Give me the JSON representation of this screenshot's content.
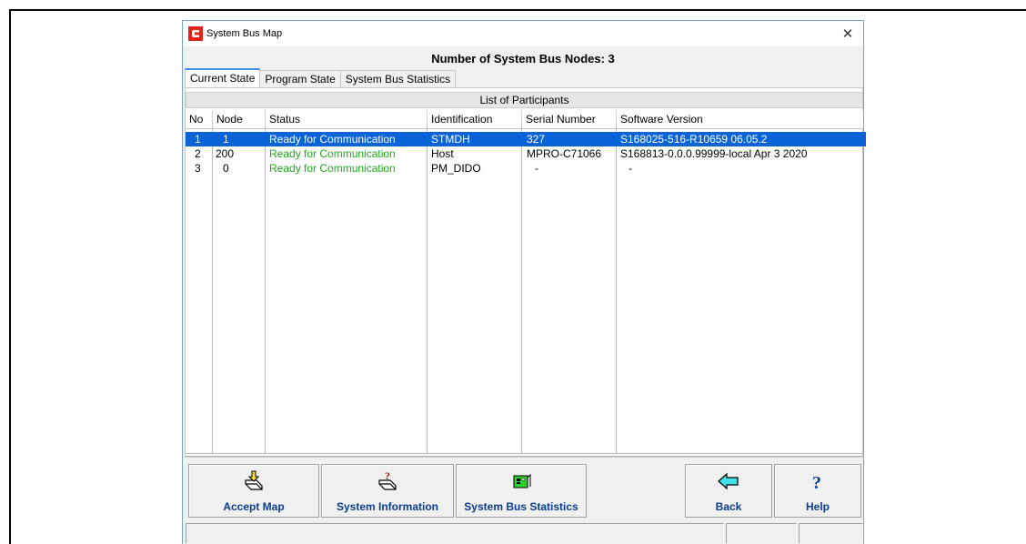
{
  "window": {
    "title": "System Bus Map",
    "close_glyph": "✕"
  },
  "header": {
    "title": "Number of System Bus Nodes: 3"
  },
  "tabs": [
    {
      "label": "Current State",
      "active": true
    },
    {
      "label": "Program State",
      "active": false
    },
    {
      "label": "System Bus Statistics",
      "active": false
    }
  ],
  "list": {
    "caption": "List of Participants",
    "columns": [
      "No",
      "Node",
      "Status",
      "Identification",
      "Serial Number",
      "Software Version"
    ],
    "rows": [
      {
        "no": "1",
        "node": "1",
        "status": "Ready for Communication",
        "identification": "STMDH",
        "serial": "327",
        "software": "S168025-516-R10659 06.05.2",
        "selected": true
      },
      {
        "no": "2",
        "node": "200",
        "status": "Ready for Communication",
        "identification": "Host",
        "serial": "MPRO-C71066",
        "software": "S168813-0.0.0.99999-local Apr  3 2020",
        "selected": false
      },
      {
        "no": "3",
        "node": "0",
        "status": "Ready for Communication",
        "identification": "PM_DIDO",
        "serial": "-",
        "software": "-",
        "selected": false
      }
    ],
    "status_color": "#1ea81e",
    "selection_color": "#0a64d8"
  },
  "buttons": {
    "accept_map": {
      "label": "Accept Map",
      "icon": "accept-map-icon"
    },
    "system_information": {
      "label": "System Information",
      "icon": "system-information-icon"
    },
    "system_bus_statistics": {
      "label": "System Bus Statistics",
      "icon": "bus-statistics-icon"
    },
    "back": {
      "label": "Back",
      "icon": "back-arrow-icon"
    },
    "help": {
      "label": "Help",
      "icon": "help-icon"
    }
  }
}
